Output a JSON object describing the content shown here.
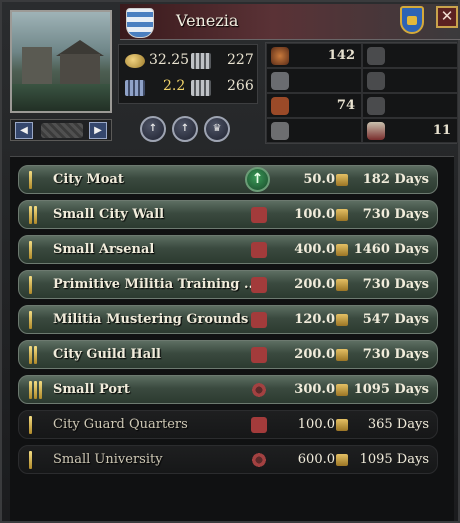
{
  "province": {
    "name": "Venezia"
  },
  "header": {
    "close_label": "✕"
  },
  "stats": {
    "gold": "32.25",
    "manpower": "227",
    "tax": "2.2",
    "levy": "266"
  },
  "action_buttons": [
    {
      "icon": "upgrade-tax-icon"
    },
    {
      "icon": "upgrade-levy-icon"
    },
    {
      "icon": "upgrade-crown-icon"
    }
  ],
  "right_panel": [
    {
      "icon": "plague-shield-icon",
      "value": "142"
    },
    {
      "icon": "horse-icon",
      "value": ""
    },
    {
      "icon": "crossed-swords-icon",
      "value": ""
    },
    {
      "icon": "horse-icon",
      "value": ""
    },
    {
      "icon": "fist-icon",
      "value": "74"
    },
    {
      "icon": "horse-icon",
      "value": ""
    },
    {
      "icon": "armor-icon",
      "value": ""
    },
    {
      "icon": "ship-icon",
      "value": "11"
    }
  ],
  "buildings": [
    {
      "name": "City Moat",
      "tier": 1,
      "icon": "upgrade",
      "cost": "50.0",
      "days": "182 Days",
      "active": true
    },
    {
      "name": "Small City Wall",
      "tier": 2,
      "icon": "scroll",
      "cost": "100.0",
      "days": "730 Days",
      "active": true
    },
    {
      "name": "Small Arsenal",
      "tier": 1,
      "icon": "scroll",
      "cost": "400.0",
      "days": "1460 Days",
      "active": true
    },
    {
      "name": "Primitive Militia Training  ...",
      "tier": 1,
      "icon": "scroll",
      "cost": "200.0",
      "days": "730 Days",
      "active": true
    },
    {
      "name": "Militia Mustering Grounds",
      "tier": 1,
      "icon": "scroll",
      "cost": "120.0",
      "days": "547 Days",
      "active": true
    },
    {
      "name": "City Guild Hall",
      "tier": 2,
      "icon": "scroll",
      "cost": "200.0",
      "days": "730 Days",
      "active": true
    },
    {
      "name": "Small Port",
      "tier": 3,
      "icon": "gear",
      "cost": "300.0",
      "days": "1095 Days",
      "active": true
    },
    {
      "name": "City Guard Quarters",
      "tier": 1,
      "icon": "scroll",
      "cost": "100.0",
      "days": "365 Days",
      "active": false
    },
    {
      "name": "Small University",
      "tier": 1,
      "icon": "gear",
      "cost": "600.0",
      "days": "1095 Days",
      "active": false
    }
  ]
}
